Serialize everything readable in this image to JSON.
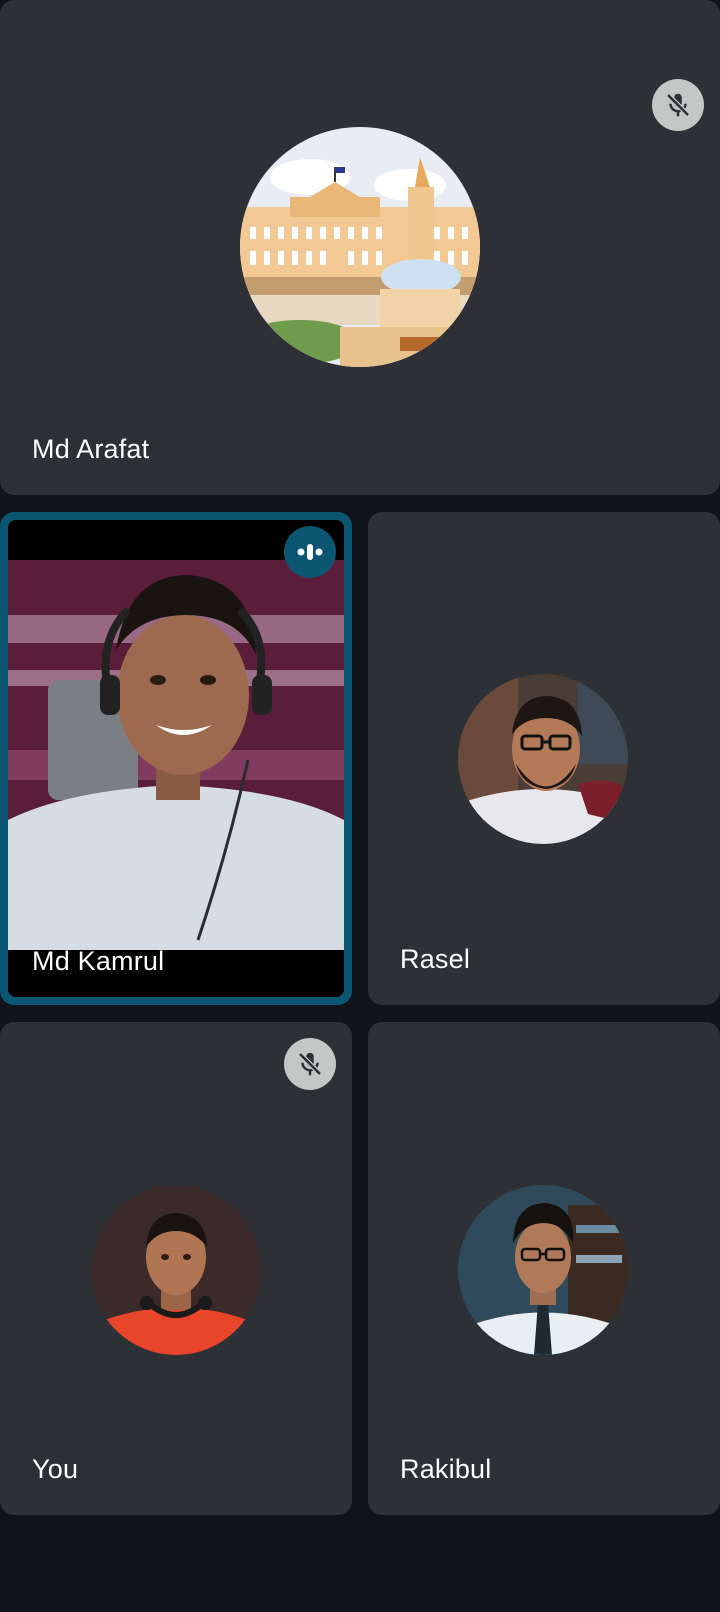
{
  "participants": [
    {
      "name": "Md Arafat",
      "mic": "muted",
      "avatar_icon": "palace-illustration-avatar"
    },
    {
      "name": "Md Kamrul",
      "mic": "speaking",
      "video": "on",
      "avatar_icon": "camera-video-feed"
    },
    {
      "name": "Rasel",
      "mic": "on",
      "avatar_icon": "profile-photo-avatar"
    },
    {
      "name": "You",
      "mic": "muted",
      "avatar_icon": "profile-photo-avatar"
    },
    {
      "name": "Rakibul",
      "mic": "on",
      "avatar_icon": "profile-photo-avatar"
    }
  ],
  "colors": {
    "background": "#0f131a",
    "tile": "#2d3034",
    "active_speaker_border": "#0b5672",
    "mute_badge": "#c4c7c5",
    "name_text": "#ffffff"
  }
}
